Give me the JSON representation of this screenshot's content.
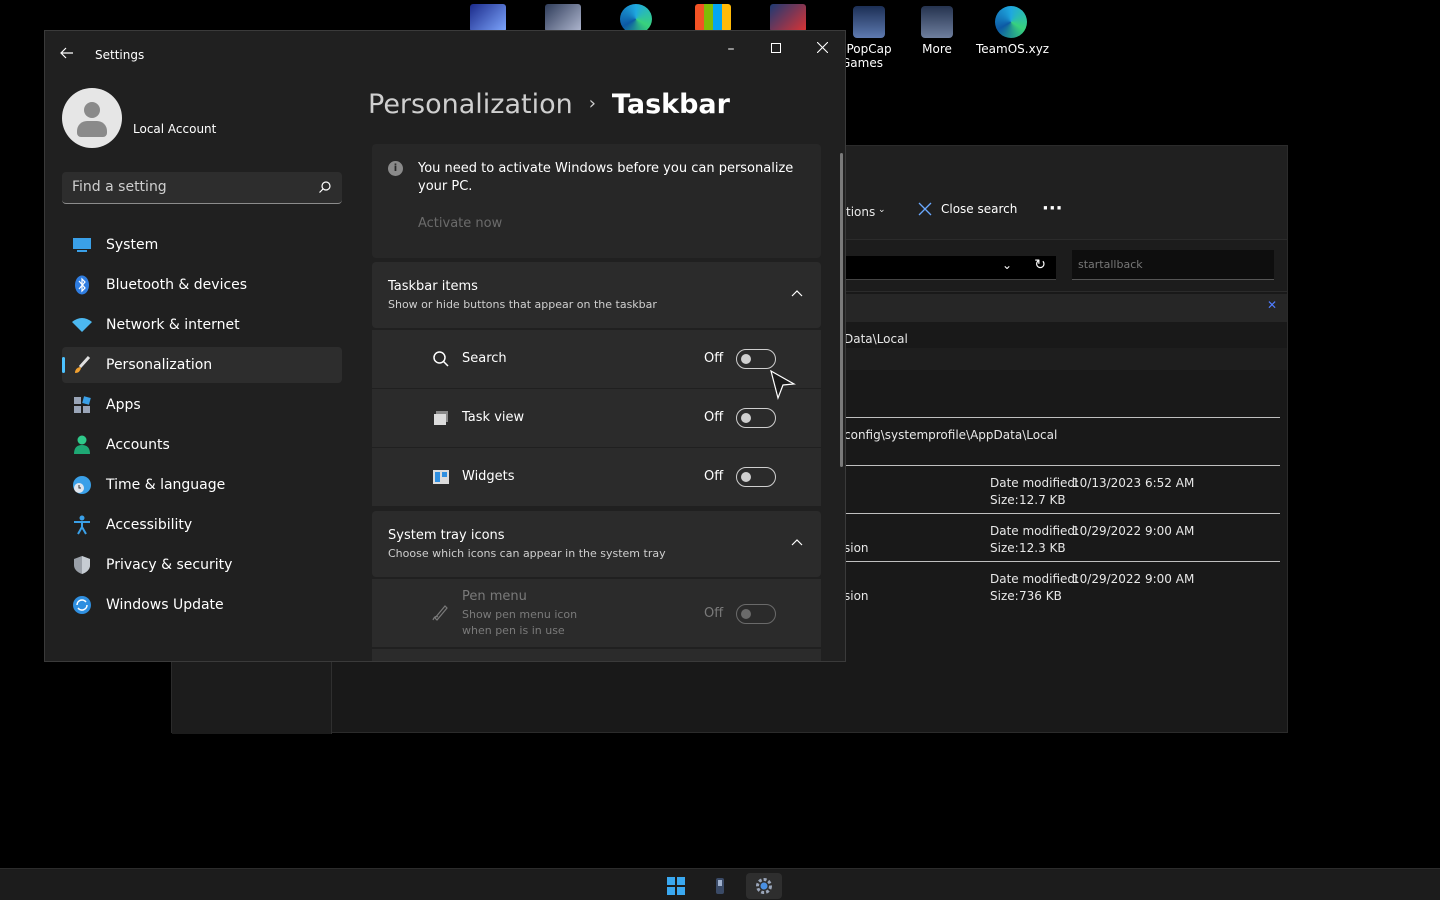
{
  "desktop": {
    "icons": [
      {
        "label": "PopCap\nGames",
        "line1": "PopCap",
        "line2": "Games"
      },
      {
        "label": "More"
      },
      {
        "label": "TeamOS.xyz"
      }
    ]
  },
  "explorer": {
    "toolbar_partial": "tions",
    "close_search": "Close search",
    "more": "···",
    "search_text": "startallback",
    "path_partial": "Data\\Local",
    "result_path": "config\\systemprofile\\AppData\\Local",
    "results": [
      {
        "partial": "",
        "date_label": "Date modified:",
        "date": "10/13/2023 6:52 AM",
        "size_label": "Size:",
        "size": "12.7 KB"
      },
      {
        "partial": "sion",
        "date_label": "Date modified:",
        "date": "10/29/2022 9:00 AM",
        "size_label": "Size:",
        "size": "12.3 KB"
      },
      {
        "partial": "sion",
        "date_label": "Date modified:",
        "date": "10/29/2022 9:00 AM",
        "size_label": "Size:",
        "size": "736 KB"
      }
    ]
  },
  "settings": {
    "title": "Settings",
    "account": "Local Account",
    "search_placeholder": "Find a setting",
    "nav": [
      {
        "label": "System",
        "icon": "system-icon"
      },
      {
        "label": "Bluetooth & devices",
        "icon": "bluetooth-icon"
      },
      {
        "label": "Network & internet",
        "icon": "wifi-icon"
      },
      {
        "label": "Personalization",
        "icon": "brush-icon",
        "active": true
      },
      {
        "label": "Apps",
        "icon": "apps-icon"
      },
      {
        "label": "Accounts",
        "icon": "accounts-icon"
      },
      {
        "label": "Time & language",
        "icon": "clock-globe-icon"
      },
      {
        "label": "Accessibility",
        "icon": "accessibility-icon"
      },
      {
        "label": "Privacy & security",
        "icon": "shield-icon"
      },
      {
        "label": "Windows Update",
        "icon": "update-icon"
      }
    ],
    "breadcrumb": {
      "parent": "Personalization",
      "separator": "›",
      "current": "Taskbar"
    },
    "activation": {
      "message": "You need to activate Windows before you can personalize your PC.",
      "link": "Activate now"
    },
    "taskbar_items": {
      "title": "Taskbar items",
      "subtitle": "Show or hide buttons that appear on the taskbar",
      "rows": [
        {
          "label": "Search",
          "state": "Off"
        },
        {
          "label": "Task view",
          "state": "Off"
        },
        {
          "label": "Widgets",
          "state": "Off"
        }
      ]
    },
    "system_tray": {
      "title": "System tray icons",
      "subtitle": "Choose which icons can appear in the system tray",
      "rows": [
        {
          "label": "Pen menu",
          "sub": "Show pen menu icon when pen is in use",
          "state": "Off"
        }
      ]
    }
  },
  "colors": {
    "accent": "#4cc2ff",
    "background": "#202020",
    "card": "#2b2b2b"
  }
}
